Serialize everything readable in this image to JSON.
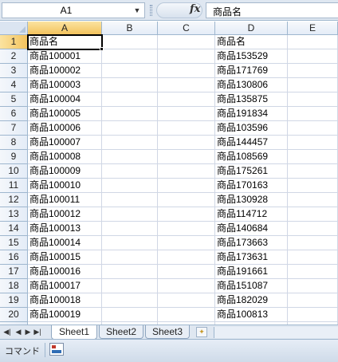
{
  "name_box": {
    "value": "A1"
  },
  "formula_bar": {
    "fx_label": "fx",
    "value": "商品名"
  },
  "columns": [
    "A",
    "B",
    "C",
    "D",
    "E"
  ],
  "rows": [
    {
      "n": "1",
      "A": "商品名",
      "D": "商品名"
    },
    {
      "n": "2",
      "A": "商品100001",
      "D": "商品153529"
    },
    {
      "n": "3",
      "A": "商品100002",
      "D": "商品171769"
    },
    {
      "n": "4",
      "A": "商品100003",
      "D": "商品130806"
    },
    {
      "n": "5",
      "A": "商品100004",
      "D": "商品135875"
    },
    {
      "n": "6",
      "A": "商品100005",
      "D": "商品191834"
    },
    {
      "n": "7",
      "A": "商品100006",
      "D": "商品103596"
    },
    {
      "n": "8",
      "A": "商品100007",
      "D": "商品144457"
    },
    {
      "n": "9",
      "A": "商品100008",
      "D": "商品108569"
    },
    {
      "n": "10",
      "A": "商品100009",
      "D": "商品175261"
    },
    {
      "n": "11",
      "A": "商品100010",
      "D": "商品170163"
    },
    {
      "n": "12",
      "A": "商品100011",
      "D": "商品130928"
    },
    {
      "n": "13",
      "A": "商品100012",
      "D": "商品114712"
    },
    {
      "n": "14",
      "A": "商品100013",
      "D": "商品140684"
    },
    {
      "n": "15",
      "A": "商品100014",
      "D": "商品173663"
    },
    {
      "n": "16",
      "A": "商品100015",
      "D": "商品173631"
    },
    {
      "n": "17",
      "A": "商品100016",
      "D": "商品191661"
    },
    {
      "n": "18",
      "A": "商品100017",
      "D": "商品151087"
    },
    {
      "n": "19",
      "A": "商品100018",
      "D": "商品182029"
    },
    {
      "n": "20",
      "A": "商品100019",
      "D": "商品100813"
    }
  ],
  "sheet_tabs": [
    "Sheet1",
    "Sheet2",
    "Sheet3"
  ],
  "active_sheet": "Sheet1",
  "status_bar": {
    "mode": "コマンド"
  },
  "colors": {
    "selected_header": "#f3c35e",
    "header_border": "#9eb6ce",
    "grid_line": "#d0d7e5"
  }
}
